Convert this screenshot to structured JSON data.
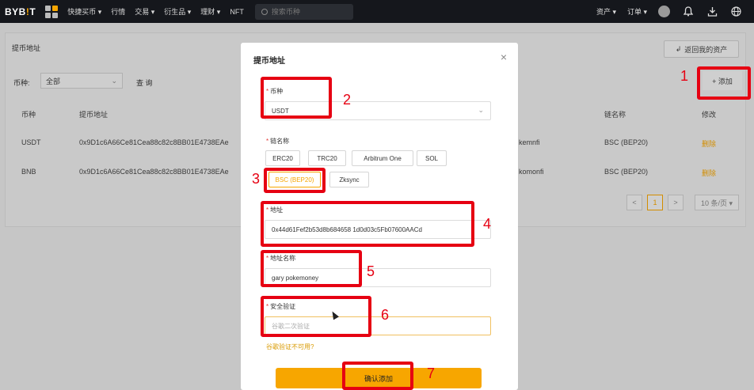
{
  "topnav": {
    "logo_text": "BYB",
    "logo_dot": "!",
    "logo_end": "T",
    "items": [
      "快捷买币 ▾",
      "行情",
      "交易 ▾",
      "衍生品 ▾",
      "理财 ▾",
      "NFT"
    ],
    "search_placeholder": "搜索币种",
    "right_items": [
      "资产 ▾",
      "订单 ▾"
    ]
  },
  "page": {
    "title": "提币地址",
    "back_label": "返回我的资产",
    "filter_label": "币种:",
    "filter_value": "全部",
    "query_label": "查 询",
    "add_label": "+ 添加",
    "columns": [
      "币种",
      "提币地址",
      "链名称",
      "修改"
    ],
    "rows": [
      {
        "coin": "USDT",
        "address": "0x9D1c6A66Ce81Cea88c82c8BB01E4738EAe",
        "remark": "kemnfi",
        "chain": "BSC (BEP20)",
        "action": "删除"
      },
      {
        "coin": "BNB",
        "address": "0x9D1c6A66Ce81Cea88c82c8BB01E4738EAe",
        "remark": "komonfi",
        "chain": "BSC (BEP20)",
        "action": "删除"
      }
    ],
    "pager": {
      "prev": "<",
      "current": "1",
      "next": ">",
      "size": "10 条/页 ▾"
    }
  },
  "modal": {
    "title": "提币地址",
    "close": "×",
    "coin_label": "币种",
    "coin_value": "USDT",
    "chain_label": "链名称",
    "chains": [
      "ERC20",
      "TRC20",
      "Arbitrum One",
      "SOL",
      "BSC (BEP20)",
      "Zksync"
    ],
    "selected_chain": "BSC (BEP20)",
    "address_label": "地址",
    "address_value": "0x44d61Fef2b53d8b684658 1d0d03c5Fb07600AACd",
    "name_label": "地址名称",
    "name_value": "gary pokemoney",
    "verify_label": "安全验证",
    "verify_placeholder": "谷歌二次验证",
    "verify_link": "谷歌验证不可用?",
    "confirm_label": "确认添加"
  },
  "annotations": [
    "1",
    "2",
    "3",
    "4",
    "5",
    "6",
    "7"
  ],
  "colors": {
    "accent": "#f7a600",
    "annotation": "#e60012",
    "nav_bg": "#15171c"
  }
}
